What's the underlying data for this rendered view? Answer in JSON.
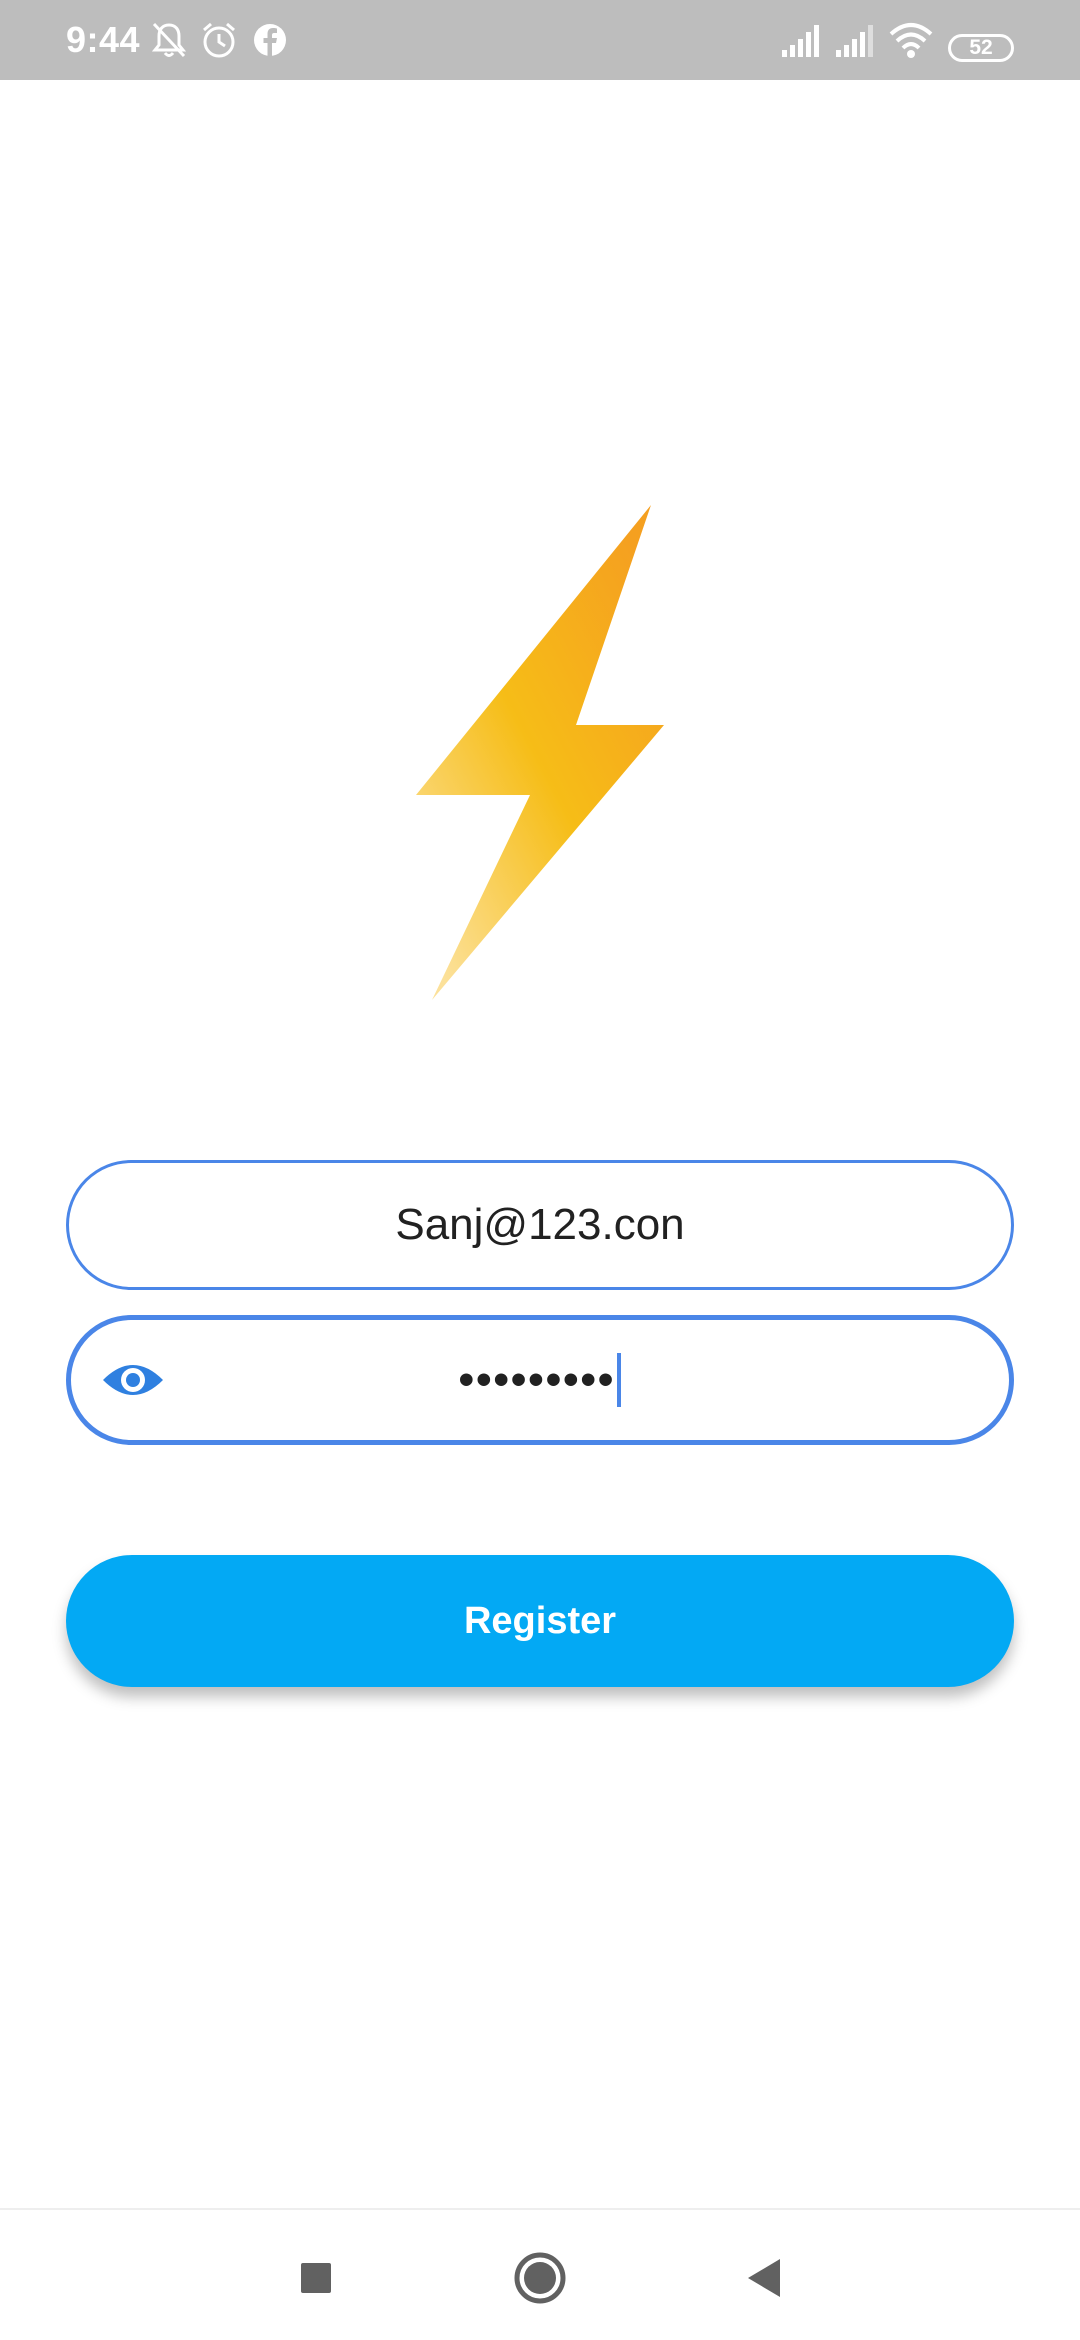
{
  "status_bar": {
    "time": "9:44",
    "battery_level": "52",
    "icons": [
      "muted-bell-icon",
      "alarm-icon",
      "facebook-icon",
      "signal-icon",
      "signal-icon",
      "wifi-icon",
      "battery-icon"
    ]
  },
  "logo": {
    "icon": "lightning-bolt-icon",
    "colors": [
      "#f5a623",
      "#f7c51b",
      "#fbe08a"
    ]
  },
  "form": {
    "email_value": "Sanj@123.con",
    "password_value": "•••••••••",
    "password_toggle_icon": "eye-icon",
    "accent_color": "#4a86e8"
  },
  "register_button": {
    "label": "Register",
    "color": "#03a9f4"
  },
  "nav_bar": {
    "icons": [
      "recents-square-icon",
      "home-circle-icon",
      "back-triangle-icon"
    ]
  }
}
